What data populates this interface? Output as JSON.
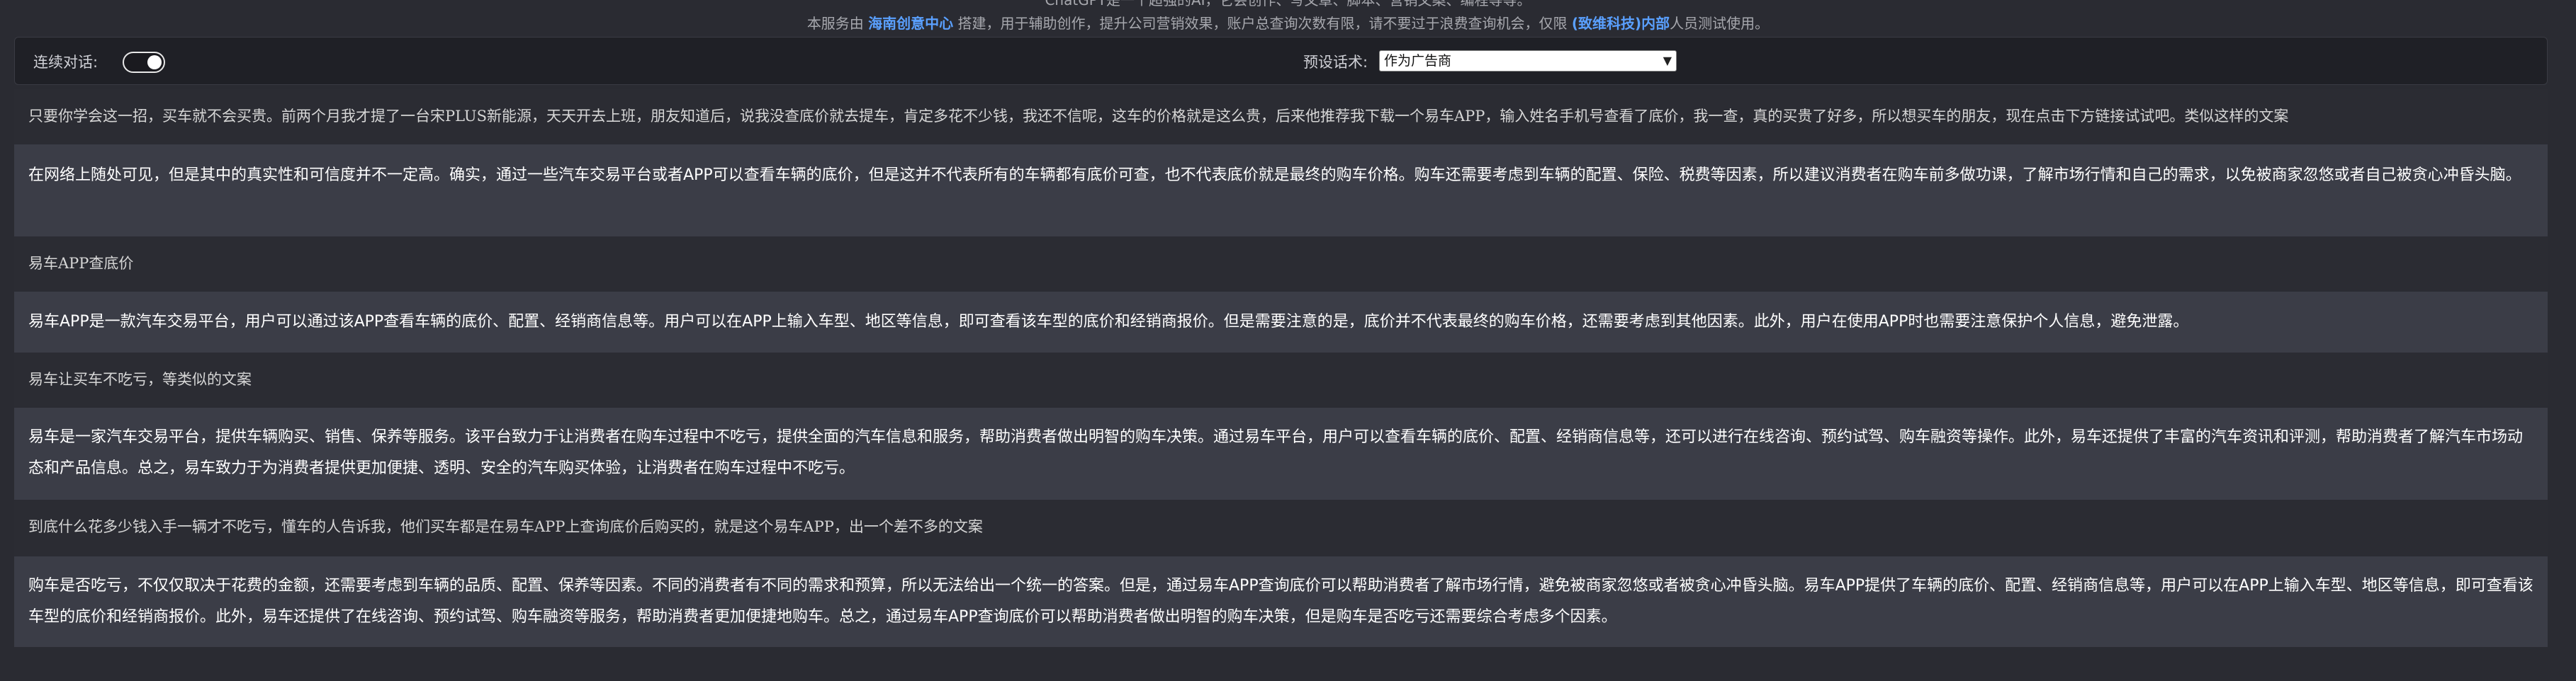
{
  "notice": {
    "line1": "ChatGPT是一个超强的AI，它会创作、写文章、脚本、营销文案、编程等等。",
    "line2_prefix": "本服务由 ",
    "line2_link1": "海南创意中心",
    "line2_mid": " 搭建，用于辅助创作，提升公司营销效果，账户总查询次数有限，请不要过于浪费查询机会，仅限 ",
    "line2_link2": "(致维科技)内部",
    "line2_suffix": "人员测试使用。"
  },
  "toolbar": {
    "continuous_label": "连续对话:",
    "continuous_on": true,
    "preset_label": "预设话术:",
    "preset_value": "作为广告商"
  },
  "messages": [
    {
      "role": "user",
      "text": "只要你学会这一招，买车就不会买贵。前两个月我才提了一台宋PLUS新能源，天天开去上班，朋友知道后，说我没查底价就去提车，肯定多花不少钱，我还不信呢，这车的价格就是这么贵，后来他推荐我下载一个易车APP，输入姓名手机号查看了底价，我一查，真的买贵了好多，所以想买车的朋友，现在点击下方链接试试吧。类似这样的文案"
    },
    {
      "role": "bot",
      "text": "在网络上随处可见，但是其中的真实性和可信度并不一定高。确实，通过一些汽车交易平台或者APP可以查看车辆的底价，但是这并不代表所有的车辆都有底价可查，也不代表底价就是最终的购车价格。购车还需要考虑到车辆的配置、保险、税费等因素，所以建议消费者在购车前多做功课，了解市场行情和自己的需求，以免被商家忽悠或者自己被贪心冲昏头脑。"
    },
    {
      "role": "user",
      "text": "易车APP查底价"
    },
    {
      "role": "bot",
      "text": "易车APP是一款汽车交易平台，用户可以通过该APP查看车辆的底价、配置、经销商信息等。用户可以在APP上输入车型、地区等信息，即可查看该车型的底价和经销商报价。但是需要注意的是，底价并不代表最终的购车价格，还需要考虑到其他因素。此外，用户在使用APP时也需要注意保护个人信息，避免泄露。"
    },
    {
      "role": "user",
      "text": "易车让买车不吃亏，等类似的文案"
    },
    {
      "role": "bot",
      "text": "易车是一家汽车交易平台，提供车辆购买、销售、保养等服务。该平台致力于让消费者在购车过程中不吃亏，提供全面的汽车信息和服务，帮助消费者做出明智的购车决策。通过易车平台，用户可以查看车辆的底价、配置、经销商信息等，还可以进行在线咨询、预约试驾、购车融资等操作。此外，易车还提供了丰富的汽车资讯和评测，帮助消费者了解汽车市场动态和产品信息。总之，易车致力于为消费者提供更加便捷、透明、安全的汽车购买体验，让消费者在购车过程中不吃亏。"
    },
    {
      "role": "user",
      "text": "到底什么花多少钱入手一辆才不吃亏，懂车的人告诉我，他们买车都是在易车APP上查询底价后购买的，就是这个易车APP，出一个差不多的文案"
    },
    {
      "role": "bot",
      "text": "购车是否吃亏，不仅仅取决于花费的金额，还需要考虑到车辆的品质、配置、保养等因素。不同的消费者有不同的需求和预算，所以无法给出一个统一的答案。但是，通过易车APP查询底价可以帮助消费者了解市场行情，避免被商家忽悠或者被贪心冲昏头脑。易车APP提供了车辆的底价、配置、经销商信息等，用户可以在APP上输入车型、地区等信息，即可查看该车型的底价和经销商报价。此外，易车还提供了在线咨询、预约试驾、购车融资等服务，帮助消费者更加便捷地购车。总之，通过易车APP查询底价可以帮助消费者做出明智的购车决策，但是购车是否吃亏还需要综合考虑多个因素。"
    }
  ]
}
